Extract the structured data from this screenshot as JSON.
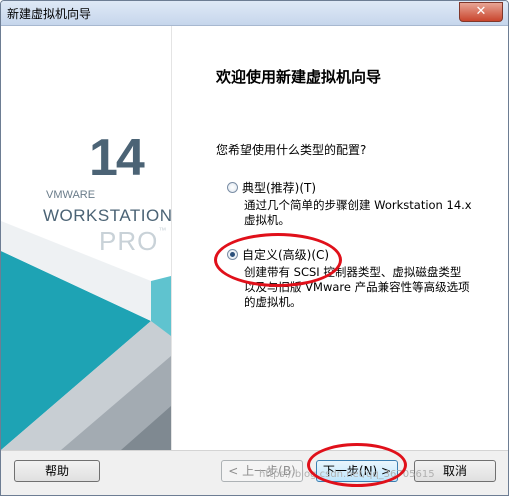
{
  "window": {
    "title": "新建虚拟机向导",
    "close_label": "✕"
  },
  "brand": {
    "version": "14",
    "company": "VMWARE",
    "product": "WORKSTATION",
    "edition": "PRO",
    "tm": "™"
  },
  "page": {
    "title": "欢迎使用新建虚拟机向导",
    "question": "您希望使用什么类型的配置?"
  },
  "options": [
    {
      "label": "典型(推荐)(T)",
      "checked": false,
      "desc_lines": [
        "通过几个简单的步骤创建 Workstation 14.x",
        "虚拟机。"
      ]
    },
    {
      "label": "自定义(高级)(C)",
      "checked": true,
      "desc_lines": [
        "创建带有 SCSI 控制器类型、虚拟磁盘类型",
        "以及与旧版 VMware 产品兼容性等高级选项",
        "的虚拟机。"
      ]
    }
  ],
  "buttons": {
    "help": "帮助",
    "back": "< 上一步(B)",
    "next": "下一步(N) >",
    "cancel": "取消"
  },
  "watermark": "https://blog.csdn.net/qq_36705615",
  "colors": {
    "annotation": "#e0101a",
    "brand_teal": "#1ea3b4",
    "brand_dark": "#4b6375"
  }
}
